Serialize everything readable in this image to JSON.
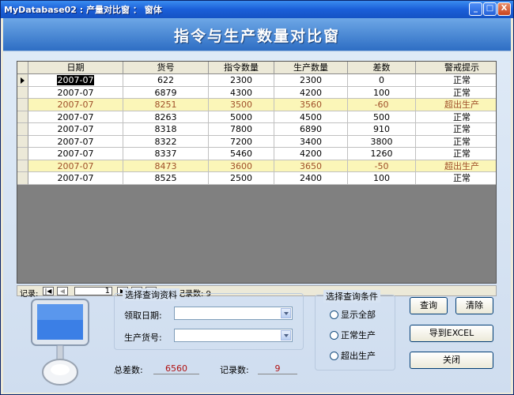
{
  "window": {
    "title": "窗体",
    "title_prefix": "MyDatabase02 : 产量对比窗 ：",
    "buttons": {
      "minimize": "_",
      "maximize": "□",
      "close": "X"
    }
  },
  "header": {
    "title": "指令与生产数量对比窗"
  },
  "grid": {
    "columns": [
      "日期",
      "货号",
      "指令数量",
      "生产数量",
      "差数",
      "警戒提示"
    ],
    "rows": [
      [
        "2007-07",
        "622",
        "2300",
        "2300",
        "0",
        "正常"
      ],
      [
        "2007-07",
        "6879",
        "4300",
        "4200",
        "100",
        "正常"
      ],
      [
        "2007-07",
        "8251",
        "3500",
        "3560",
        "-60",
        "超出生产"
      ],
      [
        "2007-07",
        "8263",
        "5000",
        "4500",
        "500",
        "正常"
      ],
      [
        "2007-07",
        "8318",
        "7800",
        "6890",
        "910",
        "正常"
      ],
      [
        "2007-07",
        "8322",
        "7200",
        "3400",
        "3800",
        "正常"
      ],
      [
        "2007-07",
        "8337",
        "5460",
        "4200",
        "1260",
        "正常"
      ],
      [
        "2007-07",
        "8473",
        "3600",
        "3650",
        "-50",
        "超出生产"
      ],
      [
        "2007-07",
        "8525",
        "2500",
        "2400",
        "100",
        "正常"
      ]
    ],
    "warn_rows": [
      2,
      7
    ]
  },
  "navigator": {
    "label": "记录:",
    "current": "1",
    "total_label": "共有记录数: 9",
    "first": "|◀",
    "prev": "◀",
    "next": "▶",
    "last": "▶|",
    "new": "▶*"
  },
  "query": {
    "legend": "选择查询资料",
    "date_label": "领取日期:",
    "item_label": "生产货号:"
  },
  "conditions": {
    "legend": "选择查询条件",
    "options": [
      "显示全部",
      "正常生产",
      "超出生产"
    ]
  },
  "buttons": {
    "query": "查询",
    "clear": "清除",
    "export": "导到EXCEL",
    "close": "关闭"
  },
  "summary": {
    "total_label": "总差数:",
    "total_value": "6560",
    "count_label": "记录数:",
    "count_value": "9"
  }
}
